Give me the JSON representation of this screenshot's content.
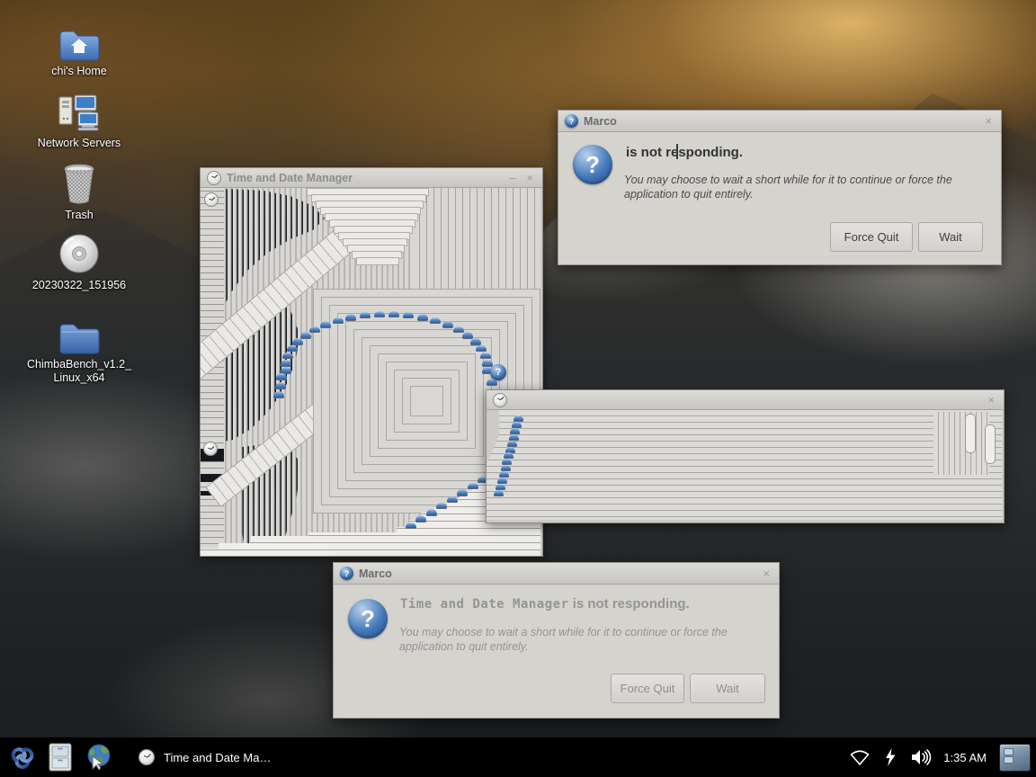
{
  "glyphs": {
    "question_mark": "?",
    "close": "×",
    "minimize": "–"
  },
  "desktop": {
    "icons": [
      {
        "icon": "home-folder-icon",
        "label": "chi's Home"
      },
      {
        "icon": "network-servers-icon",
        "label": "Network Servers"
      },
      {
        "icon": "trash-icon",
        "label": "Trash"
      },
      {
        "icon": "cd-disc-icon",
        "label": "20230322_151956"
      },
      {
        "icon": "folder-icon",
        "label": "ChimbaBench_v1.2_\nLinux_x64"
      }
    ]
  },
  "windows": {
    "time_date_manager": {
      "app_icon": "clock-icon",
      "title": "Time and Date Manager"
    },
    "glitch_popup": {
      "app_icon": "clock-icon",
      "title": ""
    },
    "dialog_active": {
      "app_icon": "question-icon",
      "title": "Marco",
      "heading": "is not responding.",
      "body": "You may choose to wait a short while for it to continue or force the application to quit entirely.",
      "force_quit_label": "Force Quit",
      "wait_label": "Wait"
    },
    "dialog_inactive": {
      "app_icon": "question-icon",
      "title": "Marco",
      "heading_app": "Time and Date Manager",
      "heading_rest": " is not responding.",
      "body": "You may choose to wait a short while for it to continue or force the application to quit entirely.",
      "force_quit_label": "Force Quit",
      "wait_label": "Wait"
    }
  },
  "taskbar": {
    "menu_icon": "distro-menu-icon",
    "file_manager_icon": "file-manager-icon",
    "browser_icon": "web-browser-icon",
    "task": {
      "icon": "clock-icon",
      "label": "Time and Date Ma…"
    },
    "tray": {
      "network_icon": "wifi-icon",
      "power_icon": "battery-charging-icon",
      "volume_icon": "volume-icon"
    },
    "clock": "1:35 AM",
    "workspace_switcher": "workspace-switcher"
  },
  "colors": {
    "accent_blue": "#3465a4",
    "dialog_bg": "#d5d3cd",
    "taskbar_bg": "#000000"
  }
}
